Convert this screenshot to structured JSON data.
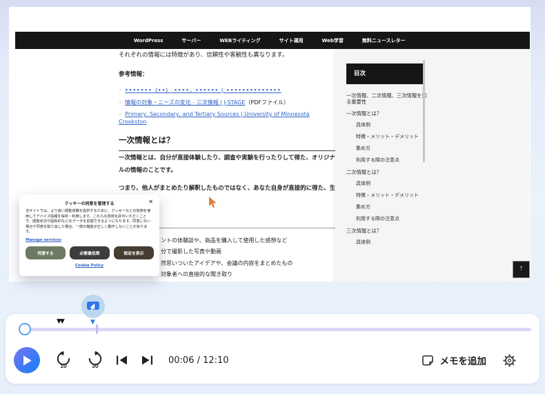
{
  "nav": {
    "items": [
      "WordPress",
      "サーバー",
      "WEBライティング",
      "サイト運用",
      "Web学習",
      "無料ニュースレター"
    ]
  },
  "article": {
    "bullet": "◦",
    "intro": "それぞれの情報には特徴があり、信頼性や客観性も異なります。",
    "references_label": "参考情報：",
    "references": [
      {
        "link": "•••••••（••） ••••、•••••• | ••••••••••••••",
        "suffix": ""
      },
      {
        "link": "情報の対象・ニーズの変化 - 三次情報 | J-STAGE",
        "suffix": "（PDFファイル）"
      },
      {
        "link": "Primary, Secondary, and Tertiary Sources | University of Minnesota Crookston",
        "suffix": ""
      }
    ],
    "heading": "一次情報とは？",
    "paragraph1": "一次情報とは、自分が直接体験したり、調査や実験を行ったりして得た、オリジナルの情報のことです。",
    "paragraph2": "つまり、他人がまとめたり解釈したものではなく、あなた自身が直接的に得た、生の情報と",
    "list_fragments": [
      "ントの体験談や、商品を購入して使用した感想など",
      "分で撮影した写真や動画",
      "然思いついたアイデアや、会議の内容をまとめたもの",
      "対象者への直接的な聞き取り"
    ]
  },
  "toc": {
    "title": "目次",
    "items": [
      {
        "label": "一次情報、二次情報、三次情報を知る重要性",
        "level": 1
      },
      {
        "label": "一次情報とは？",
        "level": 1
      },
      {
        "label": "具体例",
        "level": 2
      },
      {
        "label": "特徴・メリット・デメリット",
        "level": 2
      },
      {
        "label": "集め方",
        "level": 2
      },
      {
        "label": "利用する際の注意点",
        "level": 2
      },
      {
        "label": "二次情報とは？",
        "level": 1
      },
      {
        "label": "具体例",
        "level": 2
      },
      {
        "label": "特徴・メリット・デメリット",
        "level": 2
      },
      {
        "label": "集め方",
        "level": 2
      },
      {
        "label": "利用する際の注意点",
        "level": 2
      },
      {
        "label": "三次情報とは？",
        "level": 1
      },
      {
        "label": "具体例",
        "level": 2
      }
    ]
  },
  "back_to_top": "↑",
  "cookie_dialog": {
    "title": "クッキーの同意を管理する",
    "close": "✕",
    "body": "当サイトでは、より良い閲覧体験を提供するために、クッキーなどの技術を使用してデバイス情報を保存・利用します。これらの技術を許可いただくことで、閲覧状況や固有IDなどのデータを処理できるようになります。同意しない場合や同意を取り消した場合、一部の機能が正しく動作しないことがあります。",
    "manage_link": "Manage services",
    "buttons": [
      {
        "label": "同意する"
      },
      {
        "label": "必要最低限"
      },
      {
        "label": "設定を表示"
      }
    ],
    "policy_link": "Cookie Policy"
  },
  "player": {
    "time": "00:06 / 12:10",
    "skip_back": "10",
    "skip_forward": "30",
    "memo_label": "メモを追加"
  },
  "colors": {
    "accent_blue": "#2e7cf5",
    "progress_track": "#ddd6f6",
    "nav_bg": "#161616",
    "link_blue": "#2d62c8",
    "agree_button": "#6d7b64",
    "minimal_button": "#3d3d3d",
    "settings_button": "#453c32"
  }
}
